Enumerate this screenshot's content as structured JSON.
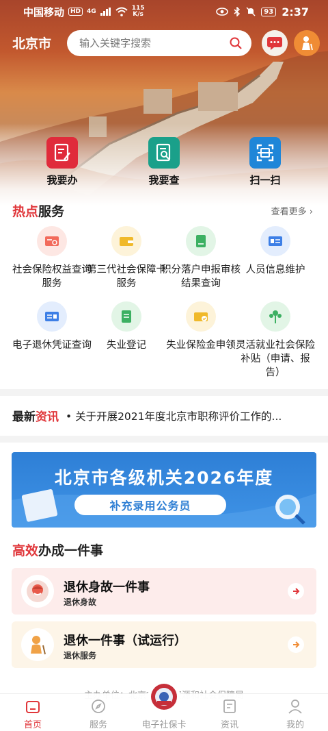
{
  "status_bar": {
    "carrier": "中国移动",
    "hd": "HD",
    "network": "4G",
    "speed_value": "115",
    "speed_unit": "K/s",
    "battery": "93",
    "time": "2:37"
  },
  "header": {
    "city": "北京市",
    "search_placeholder": "输入关键字搜索"
  },
  "quick_actions": [
    {
      "label": "我要办",
      "icon": "document-edit-icon",
      "color": "#e02b3b"
    },
    {
      "label": "我要查",
      "icon": "document-search-icon",
      "color": "#1aa08a"
    },
    {
      "label": "扫一扫",
      "icon": "scan-icon",
      "color": "#1f86d8"
    }
  ],
  "hot_services": {
    "title_highlight": "热点",
    "title_rest": "服务",
    "more": "查看更多",
    "items": [
      {
        "label": "社会保险权益查询服务",
        "icon": "card-search-icon",
        "bg": "#fde7e3",
        "fg": "#f26a5b"
      },
      {
        "label": "第三代社会保障卡服务",
        "icon": "wallet-icon",
        "bg": "#fdf3d9",
        "fg": "#f0b92a"
      },
      {
        "label": "积分落户申报审核结果查询",
        "icon": "book-icon",
        "bg": "#e2f5e6",
        "fg": "#3cb062"
      },
      {
        "label": "人员信息维护",
        "icon": "id-card-icon",
        "bg": "#e3edfd",
        "fg": "#3d7fe6"
      },
      {
        "label": "电子退休凭证查询",
        "icon": "id-card-icon",
        "bg": "#e3edfd",
        "fg": "#3d7fe6"
      },
      {
        "label": "失业登记",
        "icon": "list-card-icon",
        "bg": "#e2f5e6",
        "fg": "#3cb062"
      },
      {
        "label": "失业保险金申领",
        "icon": "wallet-check-icon",
        "bg": "#fdf3d9",
        "fg": "#f0b92a"
      },
      {
        "label": "灵活就业社会保险补贴（申请、报告）",
        "icon": "tree-icon",
        "bg": "#e2f5e6",
        "fg": "#3cb062"
      }
    ]
  },
  "news": {
    "title_rest": "最新",
    "title_highlight": "资讯",
    "headline": "• 关于开展2021年度北京市职称评价工作的..."
  },
  "banner": {
    "title": "北京市各级机关2026年度",
    "subtitle": "补充录用公务员"
  },
  "efficient": {
    "title_highlight": "高效",
    "title_rest": "办成一件事",
    "cards": [
      {
        "title": "退休身故一件事",
        "subtitle": "退休身故",
        "bg": "#fdeceb"
      },
      {
        "title": "退休一件事（试运行）",
        "subtitle": "退休服务",
        "bg": "#fdf5e8"
      }
    ]
  },
  "footer_note": "主办单位：北京市人力资源和社会保障局",
  "tabs": [
    {
      "label": "首页",
      "icon": "home-icon",
      "active": true
    },
    {
      "label": "服务",
      "icon": "compass-icon",
      "active": false
    },
    {
      "label": "电子社保卡",
      "icon": "badge-icon",
      "active": false
    },
    {
      "label": "资讯",
      "icon": "news-icon",
      "active": false
    },
    {
      "label": "我的",
      "icon": "user-icon",
      "active": false
    }
  ]
}
